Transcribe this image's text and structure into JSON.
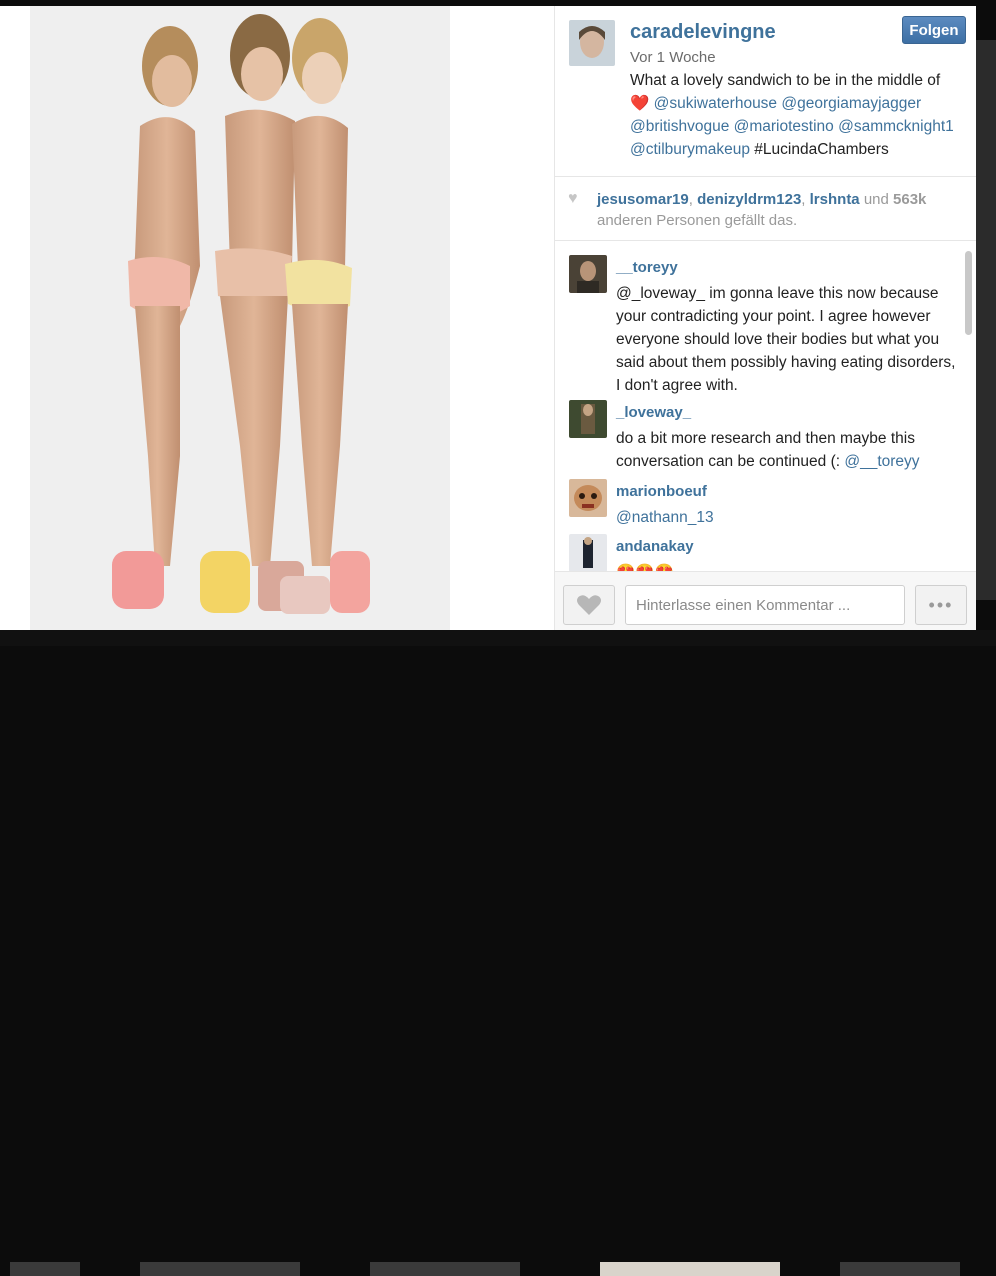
{
  "post": {
    "owner": "caradelevingne",
    "follow_label": "Folgen",
    "time": "Vor 1 Woche",
    "caption_intro": "What a lovely sandwich to be in the middle of",
    "caption_heart": "❤️",
    "caption_mentions": [
      "@sukiwaterhouse",
      "@georgiamayjagger",
      "@britishvogue",
      "@mariotestino",
      "@sammcknight1",
      "@ctilburymakeup"
    ],
    "caption_hashtag": "#LucindaChambers"
  },
  "likes": {
    "users": [
      "jesusomar19",
      "denizyldrm123",
      "lrshnta"
    ],
    "and_word": "und",
    "count": "563k",
    "suffix": "anderen Personen gefällt das."
  },
  "comments": [
    {
      "user": "__toreyy",
      "text": "@_loveway_ im gonna leave this now because your contradicting your point. I agree however everyone should love their bodies but what you said about them possibly having eating disorders, I don't agree with."
    },
    {
      "user": "_loveway_",
      "text": "do a bit more research and then maybe this conversation can be continued (: ",
      "mention": "@__toreyy"
    },
    {
      "user": "marionboeuf",
      "mention": "@nathann_13"
    },
    {
      "user": "andanakay",
      "text": "😍😍😍"
    }
  ],
  "footer": {
    "comment_placeholder": "Hinterlasse einen Kommentar ...",
    "more_label": "•••"
  },
  "icons": {
    "like": "heart-icon",
    "more": "ellipsis-icon"
  },
  "colors": {
    "link": "#3f729b",
    "follow_button": "#4a7bb0",
    "heart": "#d21f2b"
  }
}
